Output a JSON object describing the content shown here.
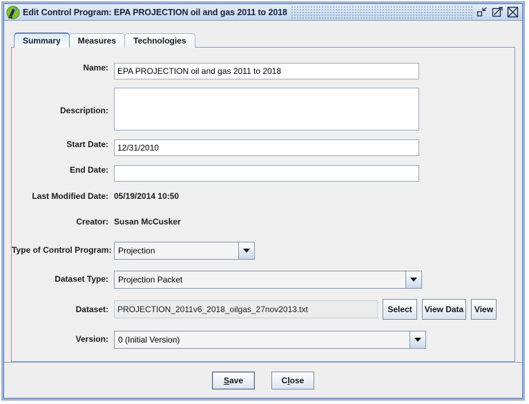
{
  "window": {
    "title": "Edit Control Program: EPA PROJECTION oil and gas 2011 to 2018",
    "icon_name": "smokestack-icon",
    "controls": {
      "restore_label": "Restore",
      "maximize_label": "Maximize",
      "close_label": "Close"
    }
  },
  "tabs": [
    {
      "label": "Summary",
      "active": true
    },
    {
      "label": "Measures",
      "active": false
    },
    {
      "label": "Technologies",
      "active": false
    }
  ],
  "summary": {
    "name": {
      "label": "Name:",
      "value": "EPA PROJECTION oil and gas 2011 to 2018",
      "placeholder": ""
    },
    "description": {
      "label": "Description:",
      "value": "",
      "placeholder": ""
    },
    "start_date": {
      "label": "Start Date:",
      "value": "12/31/2010",
      "placeholder": ""
    },
    "end_date": {
      "label": "End Date:",
      "value": "",
      "placeholder": ""
    },
    "last_modified": {
      "label": "Last Modified Date:",
      "value": "05/19/2014 10:50"
    },
    "creator": {
      "label": "Creator:",
      "value": "Susan McCusker"
    },
    "control_program_type": {
      "label": "Type of Control Program:",
      "value": "Projection"
    },
    "dataset_type": {
      "label": "Dataset Type:",
      "value": "Projection Packet"
    },
    "dataset": {
      "label": "Dataset:",
      "value": "PROJECTION_2011v6_2018_oilgas_27nov2013.txt",
      "select_label": "Select",
      "view_data_label": "View Data",
      "view_label": "View"
    },
    "version": {
      "label": "Version:",
      "value": "0 (Initial Version)"
    }
  },
  "footer": {
    "save": {
      "mnemonic": "S",
      "rest": "ave"
    },
    "close": {
      "first": "C",
      "mnemonic": "l",
      "rest": "ose"
    }
  },
  "colors": {
    "frame_blue": "#5f82b0",
    "panel_bg": "#efefef",
    "field_bg": "#ffffff",
    "disabled_field_bg": "#ececec",
    "active_tab_bg": "#eef4fb"
  }
}
